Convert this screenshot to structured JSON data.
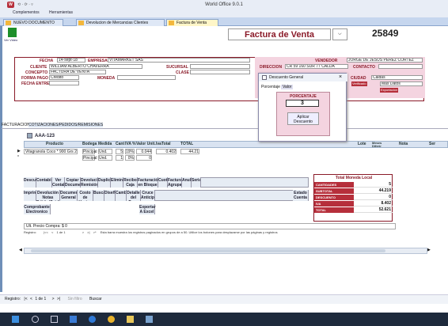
{
  "titlebar": {
    "qa": "⟲ · ⟳ · ▿",
    "title": "World Office 9.0.1"
  },
  "menu": [
    "Complementos",
    "Herramientas"
  ],
  "doc_tabs": [
    "NUEVO DOCUMENTO",
    "Devolucion de Mercancias Clientes",
    "Factura de Venta"
  ],
  "ver_video": "Ver Video",
  "doc_title": "Factura de Venta",
  "doc_number": "25849",
  "header": {
    "fecha_label": "FECHA",
    "fecha": "14-sept-18",
    "empresa_label": "EMPRESA",
    "empresa": "VITAMARKET SAS",
    "cliente_label": "CLIENTE",
    "cliente": "WILLIAM ALBERTO CHAVERRA",
    "sucursal_label": "SUCURSAL",
    "concepto_label": "CONCEPTO",
    "concepto": "FACTURA DE VENTA",
    "clase_label": "CLASE",
    "forma_pago_label": "FORMA PAGO",
    "forma_pago": "Credito",
    "moneda_label": "MONEDA",
    "fecha_entrega_label": "FECHA ENTREGA",
    "vendedor_label": "VENDEDOR",
    "vendedor": "JORGE DE JESUS PEREZ CORTEZ",
    "direccion_label": "DIRECCION",
    "direccion": "CR 59 160 SUR 77 CALDA",
    "contacto_label": "CONTACTO",
    "ciudad_label": "CIUDAD",
    "ciudad": "Caldas",
    "verificado": "Verificado",
    "mas_datos": "Mas Datos",
    "exportacion": "Exportacion"
  },
  "form_tabs": [
    "FACTURACION",
    "COTIZACIONES/PEDIDOS/REMISIONES"
  ],
  "grid_code": "AAA-123",
  "grid_headers": [
    "Producto",
    "Bodega",
    "Medida",
    "Cant",
    "IVA %",
    "Valor Unit.",
    "IvaTotal",
    "TOTAL",
    "Lote",
    "Meses Diferir",
    "Nota",
    "Ser"
  ],
  "grid_rows": [
    {
      "producto": "Vitagranola Coco * 900 Grs  2!",
      "bodega": "Pincipal",
      "medida": "Und.",
      "cant": "5",
      "iva": "19%",
      "valor_unit": "0.044",
      "iva_total": "0.402",
      "total": "44.21"
    },
    {
      "producto": "",
      "bodega": "Pincipal",
      "medida": "Und.",
      "cant": "1",
      "iva": "0%",
      "valor_unit": "0",
      "iva_total": "",
      "total": ""
    }
  ],
  "dialog": {
    "title": "Descuento General",
    "tabs": [
      "Porcentaje",
      "Valor"
    ],
    "box_label": "PORCENTAJE",
    "value": "3",
    "apply": "Aplicar Descuento"
  },
  "action_buttons_row1": [
    "Descuento",
    "Contabilizar",
    "Ver Contab",
    "Copiar Documento",
    "Devolucion Remisión",
    "Duplicar",
    "Eliminar",
    "Recibo Caja",
    "Facturación en Bloque",
    "Cuotas",
    "Factura Agrupada",
    "Anular",
    "Seriales"
  ],
  "action_buttons_row2": [
    "Imprimir",
    "Devolución Notas Débito/Crédito",
    "Documento General",
    "Costo de Ventas",
    "Buscar",
    "Diseñar",
    "Cambios",
    "Detalle del Pago",
    "Cruce Anticipo"
  ],
  "action_buttons_row3": [
    "Comprobante Electronico",
    "Exportar A Excel"
  ],
  "estado_cuenta": "Estado Cuenta",
  "totals": {
    "title": "Total Moneda Local",
    "rows": [
      [
        "CANTIDADES",
        "5"
      ],
      [
        "SUBTOTAL",
        "44.219"
      ],
      [
        "DESCUENTO",
        "0"
      ],
      [
        "IVA",
        "8.402"
      ],
      [
        "TOTAL",
        "52.621"
      ]
    ]
  },
  "precio_compra": "Ult. Precio Compra: $ 0",
  "nav": {
    "registro": "Registro:",
    "pos": "1 de 1",
    "hint": "Esta barra muestra los registros paginados en grupos de a 50. Utilice los botones para desplazarse por las páginas y registros"
  },
  "bottomnav": {
    "registro": "Registro:",
    "pos": "1 de 1",
    "filtro": "Sin filtro",
    "buscar": "Buscar"
  },
  "colors": {
    "accent": "#8a1a28",
    "tab_blue": "#c6d6ee",
    "taskbar": "#1e2a3c"
  }
}
